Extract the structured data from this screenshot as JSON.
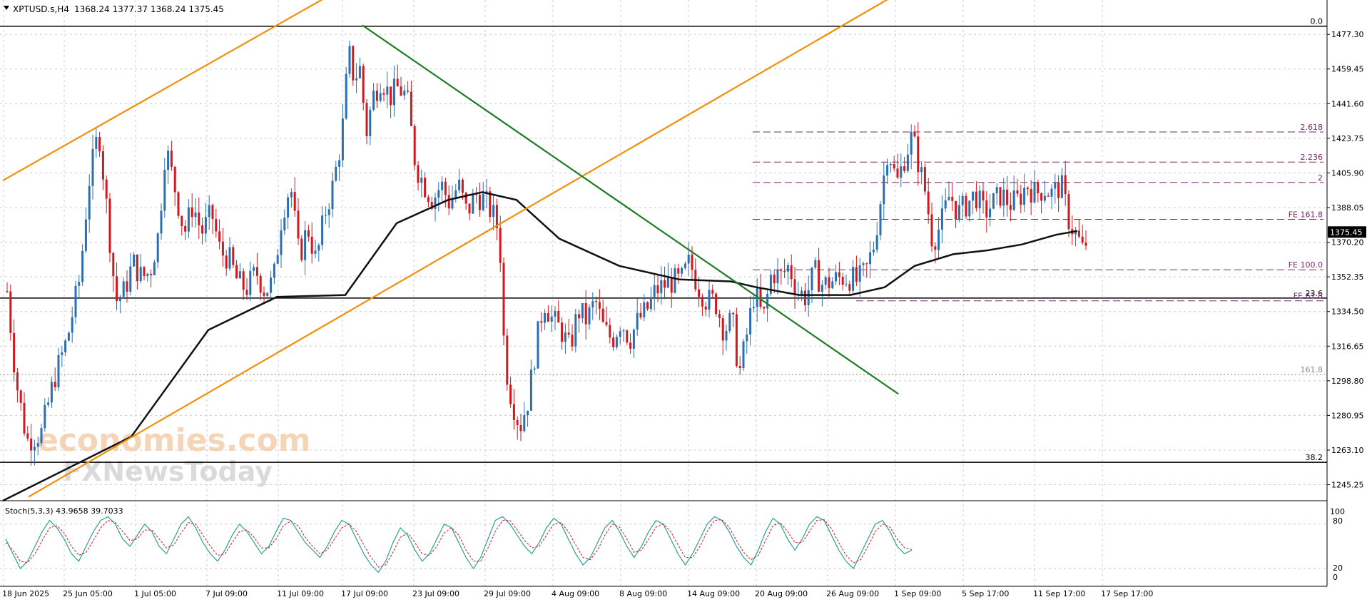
{
  "header": {
    "symbol": "XPTUSD.s,H4",
    "ohlc": "1368.24 1377.37 1368.24 1375.45"
  },
  "stoch": {
    "label": "Stoch(5,3,3) 43.9658 39.7033",
    "ticks": [
      "100",
      "80",
      "20",
      "0"
    ]
  },
  "watermark": {
    "line1": "economies.com",
    "line2": "FXNewsToday"
  },
  "chart_data": {
    "type": "candlestick",
    "ylim": [
      1237.0,
      1495.0
    ],
    "y_ticks": [
      1477.3,
      1459.45,
      1441.6,
      1423.75,
      1405.9,
      1388.05,
      1370.2,
      1352.35,
      1334.5,
      1316.65,
      1298.8,
      1280.95,
      1263.1,
      1245.25
    ],
    "last_price": 1375.45,
    "x_labels": [
      "18 Jun 2025",
      "25 Jun 05:00",
      "1 Jul 05:00",
      "7 Jul 09:00",
      "11 Jul 09:00",
      "17 Jul 09:00",
      "23 Jul 09:00",
      "29 Jul 09:00",
      "4 Aug 09:00",
      "8 Aug 09:00",
      "14 Aug 09:00",
      "20 Aug 09:00",
      "26 Aug 09:00",
      "1 Sep 09:00",
      "5 Sep 17:00",
      "11 Sep 17:00",
      "17 Sep 17:00"
    ],
    "fib_levels": [
      {
        "label": "0.0",
        "price": 1481.5
      },
      {
        "label": "23.6",
        "price": 1341.4
      },
      {
        "label": "38.2",
        "price": 1256.8
      },
      {
        "label": "161.8",
        "price": 1302.0
      }
    ],
    "fe_levels": [
      {
        "label": "2.618",
        "price": 1427.0
      },
      {
        "label": "2.236",
        "price": 1411.5
      },
      {
        "label": "2",
        "price": 1401.0
      },
      {
        "label": "FE 161.8",
        "price": 1382.0
      },
      {
        "label": "FE 100.0",
        "price": 1356.0
      },
      {
        "label": "FE 61.8",
        "price": 1340.0
      }
    ],
    "sma_points": [
      [
        0,
        1237
      ],
      [
        150,
        1270
      ],
      [
        240,
        1325
      ],
      [
        320,
        1342
      ],
      [
        400,
        1343
      ],
      [
        460,
        1380
      ],
      [
        520,
        1392
      ],
      [
        560,
        1396
      ],
      [
        600,
        1392
      ],
      [
        650,
        1372
      ],
      [
        720,
        1358
      ],
      [
        790,
        1351
      ],
      [
        850,
        1350
      ],
      [
        880,
        1347
      ],
      [
        930,
        1343
      ],
      [
        990,
        1343
      ],
      [
        1030,
        1347
      ],
      [
        1065,
        1358
      ],
      [
        1110,
        1364
      ],
      [
        1150,
        1366
      ],
      [
        1190,
        1369
      ],
      [
        1230,
        1374
      ],
      [
        1255,
        1376
      ]
    ],
    "close_path": [
      [
        5,
        1345
      ],
      [
        15,
        1300
      ],
      [
        28,
        1268
      ],
      [
        45,
        1272
      ],
      [
        60,
        1300
      ],
      [
        75,
        1320
      ],
      [
        90,
        1352
      ],
      [
        100,
        1400
      ],
      [
        112,
        1428
      ],
      [
        122,
        1385
      ],
      [
        132,
        1340
      ],
      [
        142,
        1345
      ],
      [
        152,
        1360
      ],
      [
        162,
        1352
      ],
      [
        172,
        1355
      ],
      [
        182,
        1375
      ],
      [
        190,
        1420
      ],
      [
        200,
        1400
      ],
      [
        212,
        1375
      ],
      [
        222,
        1390
      ],
      [
        232,
        1375
      ],
      [
        244,
        1385
      ],
      [
        254,
        1365
      ],
      [
        264,
        1362
      ],
      [
        274,
        1350
      ],
      [
        284,
        1346
      ],
      [
        296,
        1355
      ],
      [
        306,
        1345
      ],
      [
        316,
        1350
      ],
      [
        326,
        1385
      ],
      [
        336,
        1400
      ],
      [
        346,
        1362
      ],
      [
        356,
        1378
      ],
      [
        366,
        1360
      ],
      [
        376,
        1385
      ],
      [
        386,
        1400
      ],
      [
        396,
        1425
      ],
      [
        404,
        1468
      ],
      [
        410,
        1455
      ],
      [
        418,
        1460
      ],
      [
        424,
        1425
      ],
      [
        432,
        1445
      ],
      [
        442,
        1455
      ],
      [
        452,
        1445
      ],
      [
        462,
        1450
      ],
      [
        472,
        1445
      ],
      [
        482,
        1410
      ],
      [
        492,
        1400
      ],
      [
        502,
        1392
      ],
      [
        512,
        1400
      ],
      [
        522,
        1390
      ],
      [
        532,
        1400
      ],
      [
        542,
        1385
      ],
      [
        552,
        1395
      ],
      [
        562,
        1392
      ],
      [
        572,
        1385
      ],
      [
        580,
        1375
      ],
      [
        586,
        1310
      ],
      [
        594,
        1290
      ],
      [
        604,
        1275
      ],
      [
        614,
        1290
      ],
      [
        622,
        1315
      ],
      [
        632,
        1340
      ],
      [
        642,
        1330
      ],
      [
        652,
        1325
      ],
      [
        662,
        1315
      ],
      [
        672,
        1335
      ],
      [
        682,
        1330
      ],
      [
        692,
        1340
      ],
      [
        702,
        1325
      ],
      [
        712,
        1320
      ],
      [
        722,
        1330
      ],
      [
        732,
        1320
      ],
      [
        742,
        1330
      ],
      [
        752,
        1335
      ],
      [
        762,
        1345
      ],
      [
        772,
        1348
      ],
      [
        782,
        1350
      ],
      [
        792,
        1350
      ],
      [
        802,
        1360
      ],
      [
        812,
        1348
      ],
      [
        822,
        1340
      ],
      [
        832,
        1340
      ],
      [
        842,
        1325
      ],
      [
        852,
        1330
      ],
      [
        860,
        1302
      ],
      [
        868,
        1320
      ],
      [
        878,
        1345
      ],
      [
        888,
        1330
      ],
      [
        898,
        1355
      ],
      [
        908,
        1352
      ],
      [
        918,
        1358
      ],
      [
        928,
        1345
      ],
      [
        938,
        1342
      ],
      [
        948,
        1355
      ],
      [
        958,
        1348
      ],
      [
        968,
        1350
      ],
      [
        978,
        1352
      ],
      [
        988,
        1352
      ],
      [
        998,
        1350
      ],
      [
        1008,
        1355
      ],
      [
        1018,
        1370
      ],
      [
        1026,
        1395
      ],
      [
        1034,
        1420
      ],
      [
        1044,
        1400
      ],
      [
        1054,
        1415
      ],
      [
        1062,
        1425
      ],
      [
        1070,
        1410
      ],
      [
        1078,
        1395
      ],
      [
        1086,
        1370
      ],
      [
        1096,
        1380
      ],
      [
        1106,
        1395
      ],
      [
        1116,
        1385
      ],
      [
        1126,
        1390
      ],
      [
        1136,
        1395
      ],
      [
        1146,
        1385
      ],
      [
        1156,
        1390
      ],
      [
        1166,
        1395
      ],
      [
        1176,
        1390
      ],
      [
        1186,
        1392
      ],
      [
        1196,
        1400
      ],
      [
        1206,
        1395
      ],
      [
        1216,
        1398
      ],
      [
        1226,
        1395
      ],
      [
        1236,
        1400
      ],
      [
        1246,
        1380
      ],
      [
        1256,
        1372
      ],
      [
        1262,
        1365
      ],
      [
        1268,
        1375
      ]
    ],
    "trendlines": [
      {
        "name": "channel-upper",
        "from": [
          0,
          1402
        ],
        "to": [
          380,
          1497
        ]
      },
      {
        "name": "channel-lower",
        "from": [
          30,
          1239
        ],
        "to": [
          1040,
          1497
        ]
      },
      {
        "name": "downtrend",
        "from": [
          420,
          1482
        ],
        "to": [
          1046,
          1292
        ]
      }
    ],
    "stoch_k": [
      60,
      40,
      20,
      30,
      50,
      70,
      85,
      75,
      60,
      40,
      30,
      50,
      70,
      85,
      90,
      80,
      60,
      50,
      65,
      80,
      70,
      50,
      40,
      60,
      80,
      90,
      75,
      55,
      40,
      30,
      45,
      65,
      80,
      70,
      55,
      40,
      50,
      70,
      88,
      85,
      70,
      55,
      45,
      35,
      50,
      70,
      85,
      80,
      60,
      40,
      25,
      15,
      30,
      55,
      75,
      65,
      45,
      30,
      40,
      60,
      80,
      75,
      55,
      35,
      20,
      35,
      60,
      85,
      90,
      80,
      65,
      50,
      40,
      55,
      75,
      88,
      80,
      60,
      40,
      25,
      35,
      55,
      75,
      85,
      70,
      50,
      35,
      50,
      70,
      85,
      80,
      60,
      40,
      25,
      40,
      60,
      80,
      90,
      85,
      70,
      50,
      35,
      25,
      45,
      70,
      88,
      80,
      60,
      45,
      60,
      80,
      90,
      85,
      65,
      45,
      30,
      20,
      40,
      60,
      80,
      85,
      70,
      50,
      40,
      45
    ],
    "stoch_d": [
      55,
      45,
      30,
      28,
      40,
      58,
      75,
      78,
      68,
      50,
      38,
      42,
      58,
      75,
      85,
      82,
      70,
      58,
      60,
      72,
      72,
      60,
      48,
      52,
      68,
      82,
      80,
      65,
      50,
      38,
      40,
      55,
      70,
      72,
      62,
      48,
      48,
      60,
      78,
      84,
      78,
      62,
      50,
      40,
      45,
      60,
      75,
      80,
      70,
      52,
      35,
      22,
      25,
      42,
      62,
      68,
      55,
      40,
      38,
      50,
      68,
      75,
      65,
      45,
      30,
      30,
      48,
      70,
      85,
      85,
      72,
      58,
      48,
      50,
      65,
      80,
      82,
      70,
      52,
      35,
      32,
      45,
      65,
      80,
      76,
      60,
      42,
      45,
      60,
      76,
      80,
      70,
      52,
      35,
      35,
      50,
      70,
      85,
      86,
      76,
      58,
      42,
      32,
      38,
      58,
      78,
      82,
      70,
      55,
      55,
      70,
      85,
      86,
      74,
      55,
      38,
      28,
      32,
      50,
      70,
      80,
      76,
      60,
      48,
      46
    ]
  }
}
